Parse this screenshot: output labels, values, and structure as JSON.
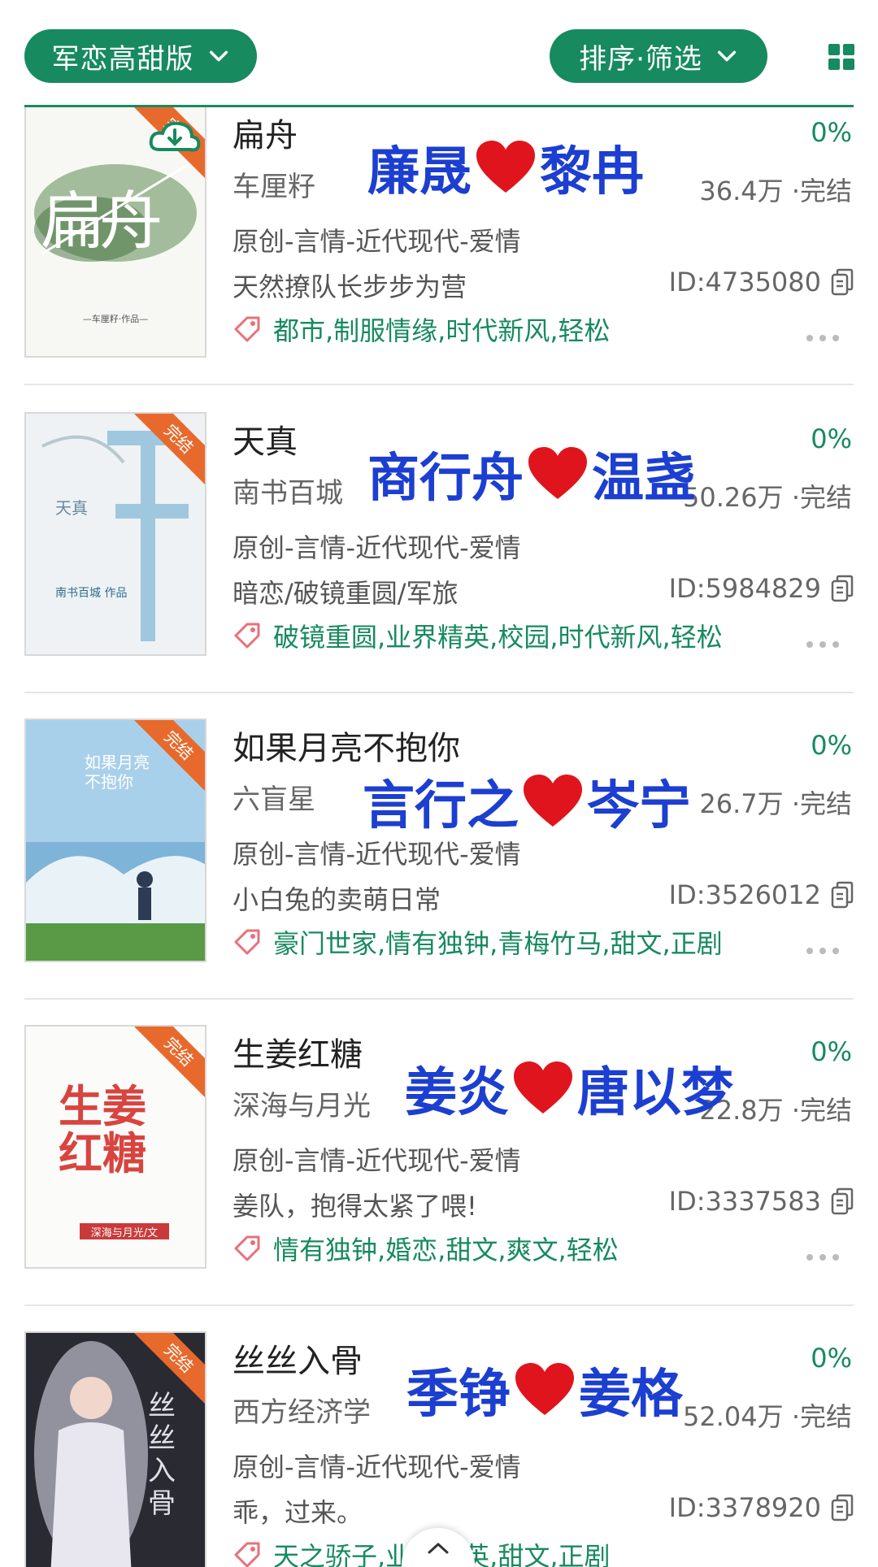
{
  "header": {
    "category_label": "军恋高甜版",
    "sort_label": "排序·筛选"
  },
  "books": [
    {
      "title": "扁舟",
      "author": "车厘籽",
      "category": "原创-言情-近代现代-爱情",
      "intro": "天然撩队长步步为营",
      "tags": "都市,制服情缘,时代新风,轻松",
      "progress": "0%",
      "stats": "36.4万 ·完结",
      "id": "ID:4735080",
      "overlay_left": "廉晟",
      "overlay_right": "黎冉",
      "cover_text": "扁舟",
      "cover_caption": "—车厘籽·作品—",
      "badge": "完结"
    },
    {
      "title": "天真",
      "author": "南书百城",
      "category": "原创-言情-近代现代-爱情",
      "intro": "暗恋/破镜重圆/军旅",
      "tags": "破镜重圆,业界精英,校园,时代新风,轻松",
      "progress": "0%",
      "stats": "50.26万 ·完结",
      "id": "ID:5984829",
      "overlay_left": "商行舟",
      "overlay_right": "温盏",
      "cover_text": "天真",
      "cover_caption": "南书百城 作品",
      "badge": "完结"
    },
    {
      "title": "如果月亮不抱你",
      "author": "六盲星",
      "category": "原创-言情-近代现代-爱情",
      "intro": "小白兔的卖萌日常",
      "tags": "豪门世家,情有独钟,青梅竹马,甜文,正剧",
      "progress": "0%",
      "stats": "26.7万 ·完结",
      "id": "ID:3526012",
      "overlay_left": "言行之",
      "overlay_right": "岑宁",
      "cover_text": "如果月亮不抱你",
      "cover_caption": "",
      "badge": "完结"
    },
    {
      "title": "生姜红糖",
      "author": "深海与月光",
      "category": "原创-言情-近代现代-爱情",
      "intro": "姜队，抱得太紧了喂!",
      "tags": "情有独钟,婚恋,甜文,爽文,轻松",
      "progress": "0%",
      "stats": "22.8万 ·完结",
      "id": "ID:3337583",
      "overlay_left": "姜炎",
      "overlay_right": "唐以梦",
      "cover_text": "生姜红糖",
      "cover_caption": "深海与月光/文",
      "badge": "完结"
    },
    {
      "title": "丝丝入骨",
      "author": "西方经济学",
      "category": "原创-言情-近代现代-爱情",
      "intro": "乖，过来。",
      "tags": "天之骄子,业界精英,甜文,正剧",
      "progress": "0%",
      "stats": "52.04万 ·完结",
      "id": "ID:3378920",
      "overlay_left": "季铮",
      "overlay_right": "姜格",
      "cover_text": "丝丝入骨",
      "cover_caption": "",
      "badge": "完结"
    }
  ],
  "colors": {
    "brand_green": "#178a5f",
    "overlay_blue": "#1c3fd1",
    "heart_red": "#e0141c",
    "ribbon_orange": "#e8692c"
  },
  "icons": [
    "chevron-down-icon",
    "grid-view-icon",
    "download-cloud-icon",
    "tag-icon",
    "copy-icon",
    "more-icon",
    "heart-icon",
    "back-to-top-icon"
  ]
}
